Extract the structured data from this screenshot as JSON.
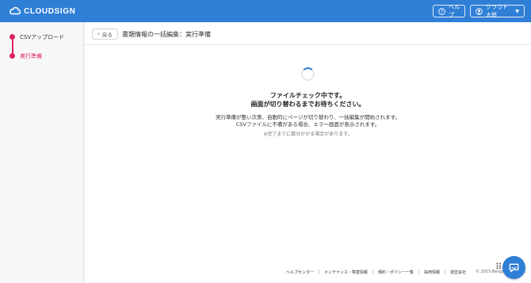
{
  "header": {
    "logo_text": "CLOUDSIGN",
    "help_label": "ヘルプ",
    "user_label": "クラウド太郎"
  },
  "sidebar": {
    "steps": [
      {
        "label": "CSVアップロード",
        "active": false
      },
      {
        "label": "実行準備",
        "active": true
      }
    ]
  },
  "subheader": {
    "back_label": "戻る",
    "title": "書類情報の一括編集：実行準備"
  },
  "status": {
    "title_line1": "ファイルチェック中です。",
    "title_line2": "画面が切り替わるまでお待ちください。",
    "body_line1": "実行準備が整い次第、自動的にページが切り替わり、一括編集が開始されます。",
    "body_line2": "CSVファイルに不備がある場合、エラー画面が表示されます。",
    "note": "※完了までに数分かかる場合があります。"
  },
  "footer": {
    "links": [
      "ヘルプセンター",
      "メンテナンス・障害情報",
      "規約・ポリシー一覧",
      "採用情報",
      "運営会社"
    ],
    "copyright": "© 2015 Bengo4.com, Inc."
  },
  "colors": {
    "brand_blue": "#2f7fd6",
    "step_pink": "#e0245e"
  },
  "icons": {
    "logo": "cloud-logo-icon",
    "help": "question-circle-icon",
    "user": "user-circle-icon",
    "back": "chevron-left-icon",
    "chat": "chat-bubble-icon",
    "grid": "grid-dots-icon"
  }
}
